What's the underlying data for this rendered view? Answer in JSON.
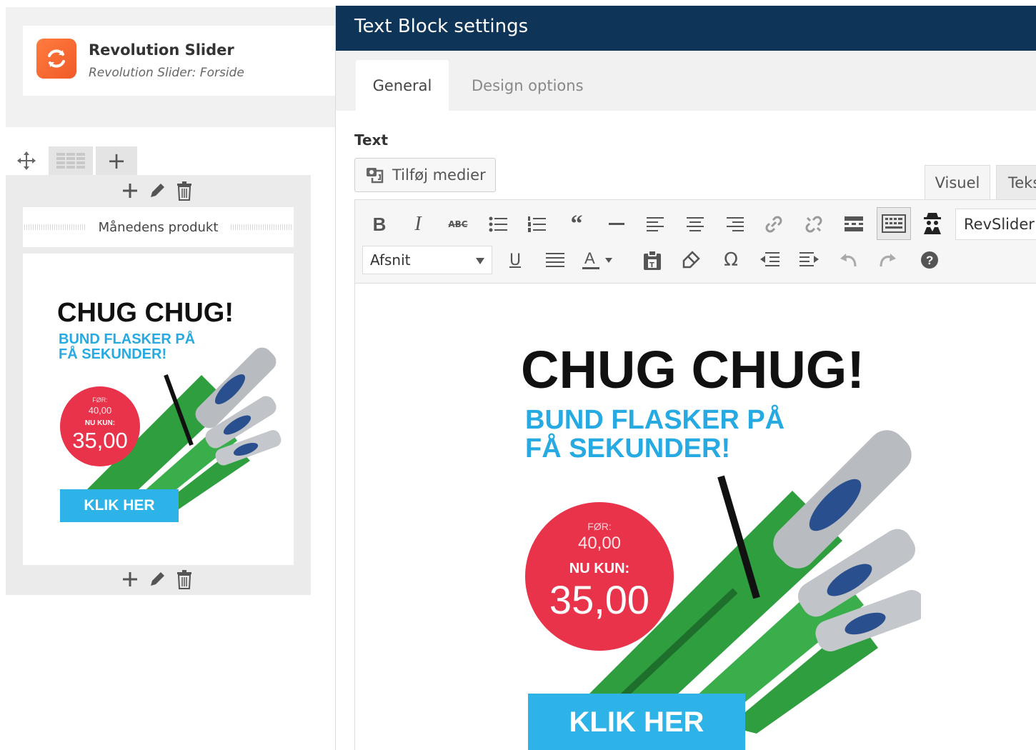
{
  "builder": {
    "revslider": {
      "title": "Revolution Slider",
      "subtitle": "Revolution Slider: Forside"
    },
    "heading_label": "Månedens produkt"
  },
  "settings": {
    "title": "Text Block settings",
    "tabs": {
      "general": "General",
      "design": "Design options"
    },
    "text_label": "Text",
    "add_media": "Tilføj medier",
    "editor_tabs": {
      "visual": "Visuel",
      "text": "Tekst"
    },
    "format_select": "Afsnit",
    "revslider_select": "RevSlider",
    "accent_colors": {
      "header": "#0e3557",
      "brand": "#f05a28"
    }
  },
  "promo": {
    "title": "CHUG CHUG!",
    "subtitle_line1": "BUND FLASKER PÅ",
    "subtitle_line2": "FÅ SEKUNDER!",
    "before_label": "FØR:",
    "old_price": "40,00",
    "now_label": "NU KUN:",
    "price": "35,00",
    "cta": "KLIK HER",
    "colors": {
      "blue": "#27aae1",
      "red": "#e8334a",
      "bottle": "#2e9e3f"
    }
  },
  "icons": {
    "toolbar_row1": [
      "bold-icon",
      "italic-icon",
      "strikethrough-icon",
      "bullet-list-icon",
      "numbered-list-icon",
      "blockquote-icon",
      "horizontal-rule-icon",
      "align-left-icon",
      "align-center-icon",
      "align-right-icon",
      "link-icon",
      "unlink-icon",
      "read-more-icon",
      "toolbar-toggle-icon",
      "shortcode-icon"
    ],
    "toolbar_row2": [
      "underline-icon",
      "justify-icon",
      "text-color-icon",
      "paste-text-icon",
      "clear-format-icon",
      "special-char-icon",
      "outdent-icon",
      "indent-icon",
      "undo-icon",
      "redo-icon",
      "help-icon"
    ]
  }
}
